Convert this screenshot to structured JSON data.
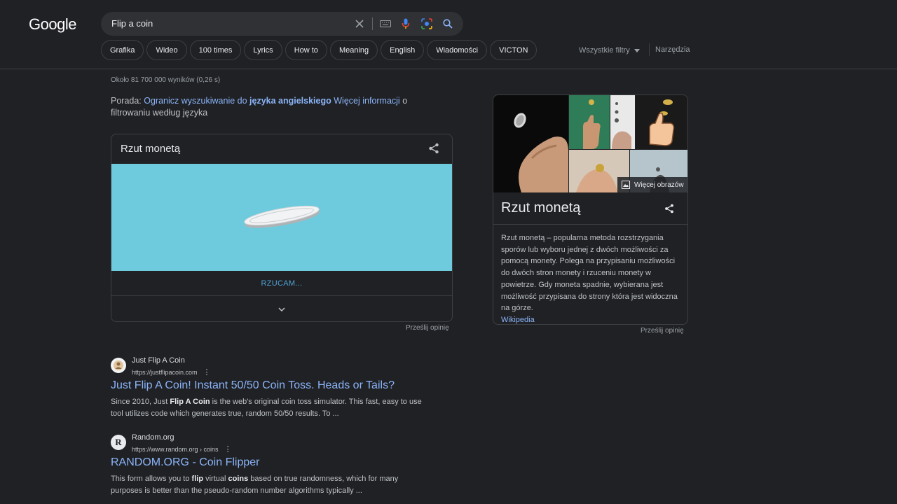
{
  "header": {
    "logo_text": "Google",
    "search": {
      "value": "Flip a coin"
    },
    "chips": [
      "Grafika",
      "Wideo",
      "100 times",
      "Lyrics",
      "How to",
      "Meaning",
      "English",
      "Wiadomości",
      "VICTON"
    ],
    "all_filters": "Wszystkie filtry",
    "tools": "Narzędzia"
  },
  "stats": "Około 81 700 000 wyników (0,26 s)",
  "tip": {
    "prefix": "Porada: ",
    "link1": "Ogranicz wyszukiwanie do ",
    "bold": "języka angielskiego",
    "link2": "Więcej informacji",
    "suffix": " o filtrowaniu według języka"
  },
  "coin_widget": {
    "title": "Rzut monetą",
    "status": "RZUCAM...",
    "feedback": "Prześlij opinię"
  },
  "results": [
    {
      "site": "Just Flip A Coin",
      "url": "https://justflipacoin.com",
      "title": "Just Flip A Coin! Instant 50/50 Coin Toss. Heads or Tails?",
      "snippet_parts": [
        "Since 2010, Just ",
        "Flip A Coin",
        " is the web's original coin toss simulator. This fast, easy to use tool utilizes code which generates true, random 50/50 results. To ..."
      ]
    },
    {
      "site": "Random.org",
      "url": "https://www.random.org › coins",
      "favicon": "R",
      "title": "RANDOM.ORG - Coin Flipper",
      "snippet_parts": [
        "This form allows you to ",
        "flip",
        " virtual ",
        "coins",
        " based on true randomness, which for many purposes is better than the pseudo-random number algorithms typically ..."
      ]
    }
  ],
  "knowledge_panel": {
    "more_images": "Więcej obrazów",
    "title": "Rzut monetą",
    "description": "Rzut monetą – popularna metoda rozstrzygania sporów lub wyboru jednej z dwóch możliwości za pomocą monety. Polega na przypisaniu możliwości do dwóch stron monety i rzuceniu monety w powietrze. Gdy moneta spadnie, wybierana jest możliwość przypisana do strony która jest widoczna na górze.",
    "source": "Wikipedia",
    "feedback": "Prześlij opinię"
  },
  "colors": {
    "background": "#202124",
    "link": "#8ab4f8",
    "coin_bg": "#6ecbdd"
  }
}
